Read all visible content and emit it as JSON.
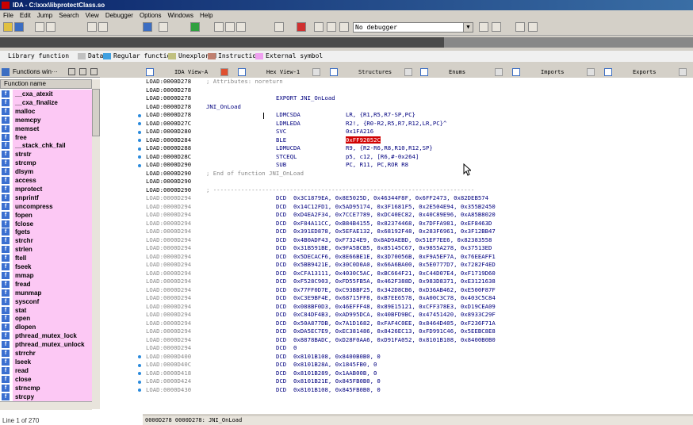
{
  "window": {
    "title": "IDA - C:\\xxx\\libprotectClass.so"
  },
  "menu": [
    "File",
    "Edit",
    "Jump",
    "Search",
    "View",
    "Debugger",
    "Options",
    "Windows",
    "Help"
  ],
  "debugger_select": {
    "value": "No debugger"
  },
  "legend": [
    {
      "label": "Library function",
      "color": "#80d0f0"
    },
    {
      "label": "Data",
      "color": "#c0c0c0"
    },
    {
      "label": "Regular function",
      "color": "#40a0e0"
    },
    {
      "label": "Unexplored",
      "color": "#c0c080"
    },
    {
      "label": "Instruction",
      "color": "#c08070"
    },
    {
      "label": "External symbol",
      "color": "#f0a0f0"
    }
  ],
  "functions_panel": {
    "title": "Functions win···",
    "column": "Function name",
    "status": "Line 1 of 270",
    "items": [
      "__cxa_atexit",
      "__cxa_finalize",
      "malloc",
      "memcpy",
      "memset",
      "free",
      "__stack_chk_fail",
      "strstr",
      "strcmp",
      "dlsym",
      "access",
      "mprotect",
      "snprintf",
      "uncompress",
      "fopen",
      "fclose",
      "fgets",
      "strchr",
      "strlen",
      "ftell",
      "fseek",
      "mmap",
      "fread",
      "munmap",
      "sysconf",
      "stat",
      "open",
      "dlopen",
      "pthread_mutex_lock",
      "pthread_mutex_unlock",
      "strrchr",
      "lseek",
      "read",
      "close",
      "strncmp",
      "strcpy"
    ]
  },
  "tabs": [
    {
      "label": "IDA View-A",
      "close_red": true
    },
    {
      "label": "Hex View-1",
      "close_red": false
    },
    {
      "label": "Structures",
      "close_red": false
    },
    {
      "label": "Enums",
      "close_red": false
    },
    {
      "label": "Imports",
      "close_red": false
    },
    {
      "label": "Exports",
      "close_red": false
    }
  ],
  "code_top": [
    {
      "addr": "LOAD:0000D278",
      "gray": false,
      "kind": "comment",
      "text": "; Attributes: noreturn"
    },
    {
      "addr": "LOAD:0000D278",
      "gray": false,
      "kind": "blank"
    },
    {
      "addr": "LOAD:0000D278",
      "gray": false,
      "kind": "export",
      "mnem": "EXPORT JNI_OnLoad"
    },
    {
      "addr": "LOAD:0000D278",
      "gray": false,
      "kind": "label",
      "label": "JNI_OnLoad"
    },
    {
      "addr": "LOAD:0000D278",
      "gray": false,
      "kind": "ins",
      "mnem": "LDMCSDA",
      "ops": "LR, {R1,R5,R7-SP,PC}",
      "dot": true,
      "cursor": true
    },
    {
      "addr": "LOAD:0000D27C",
      "gray": false,
      "kind": "ins",
      "mnem": "LDMLEDA",
      "ops": "R2!, {R0-R2,R5,R7,R12,LR,PC}^",
      "dot": true
    },
    {
      "addr": "LOAD:0000D280",
      "gray": false,
      "kind": "ins",
      "mnem": "SVC",
      "ops": "0x1FA216",
      "dot": true
    },
    {
      "addr": "LOAD:0000D284",
      "gray": false,
      "kind": "ins",
      "mnem": "BLE",
      "ops": "0xFF92052C",
      "hl": true,
      "dot": true
    },
    {
      "addr": "LOAD:0000D288",
      "gray": false,
      "kind": "ins",
      "mnem": "LDMUCDA",
      "ops": "R9, {R2-R6,R8,R10,R12,SP}",
      "dot": true
    },
    {
      "addr": "LOAD:0000D28C",
      "gray": false,
      "kind": "ins",
      "mnem": "STCEQL",
      "ops": "p5, c12, [R6,#-0x264]",
      "dot": true
    },
    {
      "addr": "LOAD:0000D290",
      "gray": false,
      "kind": "ins",
      "mnem": "SUB",
      "ops": "PC, R11, PC,ROR R8",
      "dot": true
    },
    {
      "addr": "LOAD:0000D290",
      "gray": false,
      "kind": "comment",
      "text": "; End of function JNI_OnLoad"
    },
    {
      "addr": "LOAD:0000D290",
      "gray": false,
      "kind": "blank"
    },
    {
      "addr": "LOAD:0000D290",
      "gray": false,
      "kind": "comment",
      "text": "; ---------------------------------------------------------------------------"
    }
  ],
  "dcd_lines": [
    {
      "addr": "LOAD:0000D294",
      "vals": "0x3C1879EA, 0x8E5025D, 0x46344F8F, 0x6FF2473, 0x82DEB574"
    },
    {
      "addr": "LOAD:0000D294",
      "vals": "0x14C12FD1, 0x5AD95174, 0x3F1681F5, 0x2E504E94, 0x355B2450"
    },
    {
      "addr": "LOAD:0000D294",
      "vals": "0xD4EA2F34, 0x7CCE7789, 0xDC40EC82, 0x40C89E96, 0xA85B8020"
    },
    {
      "addr": "LOAD:0000D294",
      "vals": "0xF84A11CC, 0xB84B4155, 0x82374468, 0x7DFFA981, 0xEF8463D"
    },
    {
      "addr": "LOAD:0000D294",
      "vals": "0x391ED878, 0x5EFAE132, 0x68192F48, 0x283F6961, 0x3F12BB47"
    },
    {
      "addr": "LOAD:0000D294",
      "vals": "0x4B0ADF43, 0xF7324E9, 0x8AD9AEBD, 0x51EF7EE6, 0x82383558"
    },
    {
      "addr": "LOAD:0000D294",
      "vals": "0x31B591BE, 0x9FA5BCB5, 0x85145C67, 0x9855A278, 0x37513ED"
    },
    {
      "addr": "LOAD:0000D294",
      "vals": "0x5DECACF6, 0x8E66BE1E, 0x3D70056B, 0xF9A5EF7A, 0x76EEAFF1"
    },
    {
      "addr": "LOAD:0000D294",
      "vals": "0x5BB9421E, 0x30C0D0A0, 0x66A6BA00, 0x5E0777D7, 0x7282F4ED"
    },
    {
      "addr": "LOAD:0000D294",
      "vals": "0xCFA13111, 0x4030C5AC, 0xBC664F21, 0xC44D07E4, 0xF1719D60"
    },
    {
      "addr": "LOAD:0000D294",
      "vals": "0xF528C903, 0xFD55FB5A, 0x462F388D, 0x983D8371, 0xE3121638"
    },
    {
      "addr": "LOAD:0000D294",
      "vals": "0x77FF0D7E, 0xC93BBF25, 0x342D8CB6, 0xD36AB462, 0xE500F87F"
    },
    {
      "addr": "LOAD:0000D294",
      "vals": "0xC3E9BF4E, 0x68715FF8, 0xB7EE6578, 0xA00C3C78, 0x403C5C84"
    },
    {
      "addr": "LOAD:0000D294",
      "vals": "0x088BF0D3, 0x46EFFF48, 0x89E15121, 0xCFF378E3, 0xD19CEA09"
    },
    {
      "addr": "LOAD:0000D294",
      "vals": "0xC84DF4B3, 0xAD995DCA, 0x40BFD9BC, 0x47451420, 0x8933C29F"
    },
    {
      "addr": "LOAD:0000D294",
      "vals": "0x50A877DB, 0x7A1D1682, 0xFAF4C0EE, 0x8464D405, 0xF236F71A"
    },
    {
      "addr": "LOAD:0000D294",
      "vals": "0xDA5EC7E9, 0xEC381486, 0x8426EC13, 0xFD991C46, 0x5EEBC8E8"
    },
    {
      "addr": "LOAD:0000D294",
      "vals": "0x8878BADC, 0xD28F0AA6, 0xD91FA052, 0x8101B108, 0x8400B0B0"
    },
    {
      "addr": "LOAD:0000D294",
      "vals": "0"
    },
    {
      "addr": "LOAD:0000D400",
      "vals": "0x8101B108, 0x8400B0B0, 0",
      "dot": true
    },
    {
      "addr": "LOAD:0000D40C",
      "vals": "0x8101B28A, 0x1845FB0, 0",
      "dot": true
    },
    {
      "addr": "LOAD:0000D418",
      "vals": "0x8101B289, 0x1AAB00B, 0",
      "dot": true
    },
    {
      "addr": "LOAD:0000D424",
      "vals": "0x8101B21E, 0x845FB0B0, 0",
      "dot": true
    },
    {
      "addr": "LOAD:0000D430",
      "vals": "0x8101B108, 0x845FB0B0, 0",
      "dot": true
    }
  ],
  "status_bar": "0000D278 0000D278: JNI_OnLoad"
}
